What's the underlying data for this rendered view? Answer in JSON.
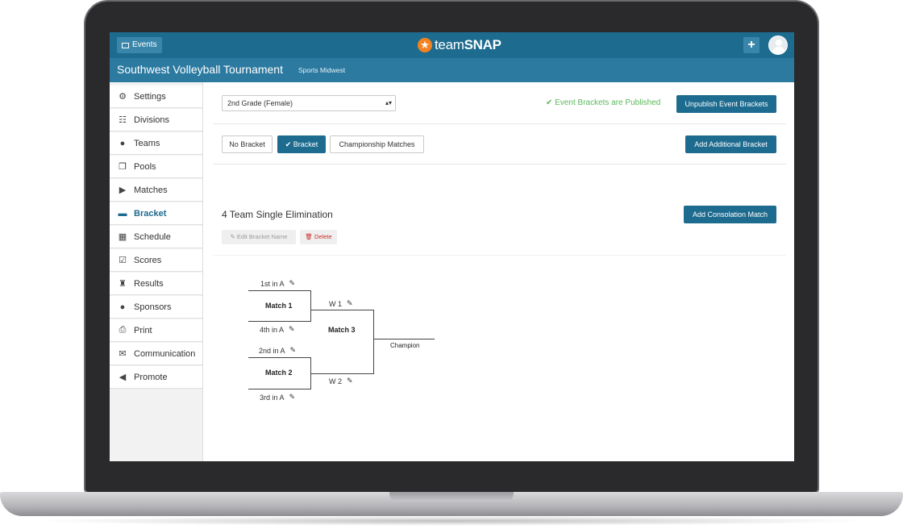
{
  "header": {
    "events_label": "Events",
    "logo_prefix": "team",
    "logo_suffix": "SNAP",
    "plus_label": "+"
  },
  "subheader": {
    "title": "Southwest Volleyball Tournament",
    "org": "Sports Midwest"
  },
  "sidebar": {
    "items": [
      {
        "label": "Settings",
        "icon": "gear-icon",
        "glyph": "⚙"
      },
      {
        "label": "Divisions",
        "icon": "sitemap-icon",
        "glyph": "☷"
      },
      {
        "label": "Teams",
        "icon": "users-icon",
        "glyph": "👥"
      },
      {
        "label": "Pools",
        "icon": "copy-icon",
        "glyph": "❐"
      },
      {
        "label": "Matches",
        "icon": "play-icon",
        "glyph": "▶"
      },
      {
        "label": "Bracket",
        "icon": "bracket-icon",
        "glyph": "▬",
        "active": true
      },
      {
        "label": "Schedule",
        "icon": "calendar-icon",
        "glyph": "▦"
      },
      {
        "label": "Scores",
        "icon": "calendar-check-icon",
        "glyph": "☑"
      },
      {
        "label": "Results",
        "icon": "trophy-icon",
        "glyph": "🏆"
      },
      {
        "label": "Sponsors",
        "icon": "users-icon",
        "glyph": "👥"
      },
      {
        "label": "Print",
        "icon": "print-icon",
        "glyph": "⎙"
      },
      {
        "label": "Communication",
        "icon": "comments-icon",
        "glyph": "💬"
      },
      {
        "label": "Promote",
        "icon": "bullhorn-icon",
        "glyph": "📣"
      }
    ]
  },
  "main": {
    "division_select": "2nd Grade (Female)",
    "published_status": "Event Brackets are Published",
    "unpublish_label": "Unpublish Event Brackets",
    "mode_buttons": [
      "No Bracket",
      "Bracket",
      "Championship Matches"
    ],
    "add_bracket_label": "Add Additional Bracket",
    "bracket_name": "4 Team Single Elimination",
    "add_consolation_label": "Add Consolation Match",
    "edit_name_label": "Edit Bracket Name",
    "delete_label": "Delete"
  },
  "bracket": {
    "seeds": [
      "1st in A",
      "4th in A",
      "2nd in A",
      "3rd in A"
    ],
    "matches": [
      "Match 1",
      "Match 2",
      "Match 3"
    ],
    "winners": [
      "W 1",
      "W 2"
    ],
    "champion": "Champion"
  },
  "colors": {
    "brand_dark": "#1d6b8f",
    "brand_light": "#2c7aa0",
    "success": "#5cb85c",
    "danger": "#c9302c",
    "logo_star": "#f58220"
  }
}
